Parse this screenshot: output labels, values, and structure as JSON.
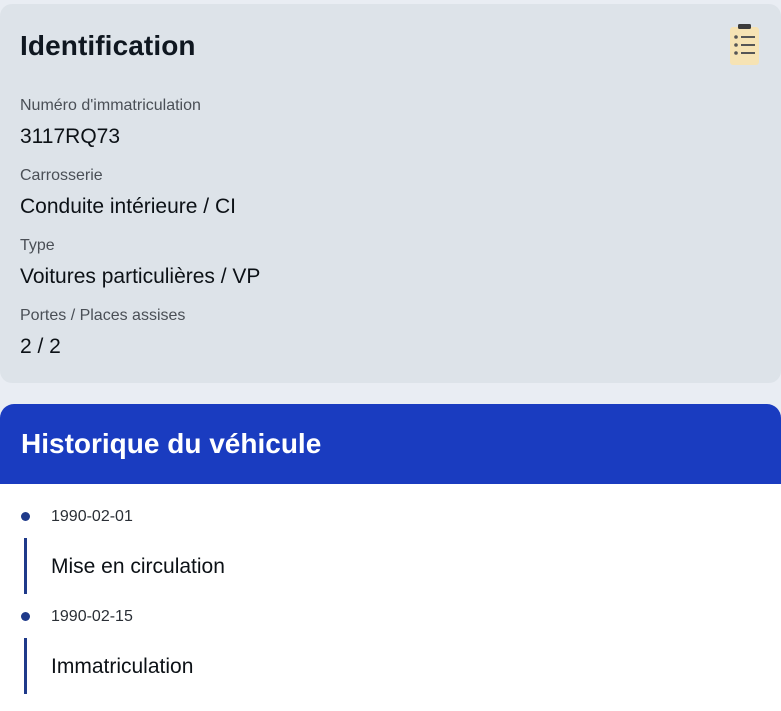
{
  "identification": {
    "title": "Identification",
    "icon": "clipboard-list-icon",
    "fields": [
      {
        "label": "Numéro d'immatriculation",
        "value": "3117RQ73"
      },
      {
        "label": "Carrosserie",
        "value": "Conduite intérieure / CI"
      },
      {
        "label": "Type",
        "value": "Voitures particulières / VP"
      },
      {
        "label": "Portes / Places assises",
        "value": "2 / 2"
      }
    ]
  },
  "historique": {
    "title": "Historique du véhicule",
    "events": [
      {
        "date": "1990-02-01",
        "label": "Mise en circulation"
      },
      {
        "date": "1990-02-15",
        "label": "Immatriculation"
      }
    ]
  },
  "colors": {
    "header_blue": "#1a3cc0",
    "timeline": "#1f3a8a",
    "ident_bg": "#dde3e9"
  }
}
